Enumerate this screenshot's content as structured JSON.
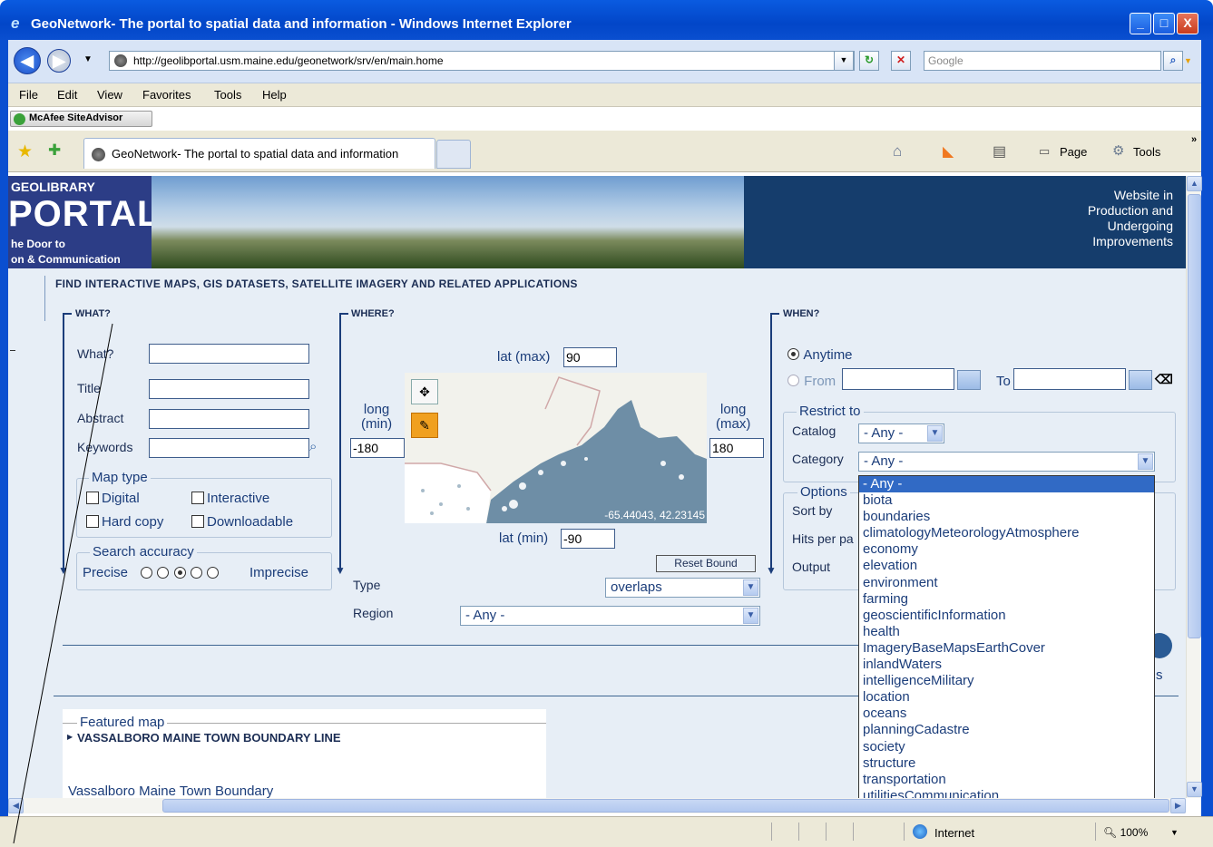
{
  "window": {
    "title": "GeoNetwork- The portal to spatial data and information - Windows Internet Explorer",
    "minimize": "_",
    "maximize": "□",
    "close": "X"
  },
  "address": {
    "url": "http://geolibportal.usm.maine.edu/geonetwork/srv/en/main.home",
    "search_placeholder": "Google"
  },
  "menu": [
    "File",
    "Edit",
    "View",
    "Favorites",
    "Tools",
    "Help"
  ],
  "mcafee": "McAfee SiteAdvisor",
  "tab": {
    "label": "GeoNetwork- The portal to spatial data and information"
  },
  "commandbar": {
    "page": "Page",
    "tools": "Tools"
  },
  "banner": {
    "logo_line1": "GEOLIBRARY",
    "logo_line2": "PORTAL",
    "logo_line3": "he Door to",
    "logo_line4": "on & Communication",
    "notice": "Website in\nProduction and\nUndergoing\nImprovements"
  },
  "search": {
    "heading": "FIND INTERACTIVE MAPS, GIS DATASETS, SATELLITE IMAGERY AND RELATED APPLICATIONS",
    "what": {
      "heading": "WHAT?",
      "fields": [
        "What?",
        "Title",
        "Abstract",
        "Keywords"
      ],
      "map_type_legend": "Map type",
      "map_types": [
        "Digital",
        "Interactive",
        "Hard copy",
        "Downloadable"
      ],
      "accuracy_legend": "Search accuracy",
      "accuracy_left": "Precise",
      "accuracy_right": "Imprecise",
      "accuracy_selected_index": 1
    },
    "where": {
      "heading": "WHERE?",
      "lat_max_label": "lat (max)",
      "lat_max": "90",
      "lat_min_label": "lat (min)",
      "lat_min": "-90",
      "long_min_label": "long\n(min)",
      "long_min": "-180",
      "long_max_label": "long\n(max)",
      "long_max": "180",
      "coords": "-65.44043, 42.23145",
      "reset_label": "Reset Bound",
      "type_label": "Type",
      "type_value": "overlaps",
      "region_label": "Region",
      "region_value": "- Any -"
    },
    "when": {
      "heading": "WHEN?",
      "anytime": "Anytime",
      "from": "From",
      "to": "To",
      "restrict_legend": "Restrict to",
      "catalog_label": "Catalog",
      "catalog_value": "- Any -",
      "category_label": "Category",
      "category_value": "- Any -",
      "options_legend": "Options",
      "sort_label": "Sort by",
      "hits_label": "Hits per pa",
      "output_label": "Output",
      "partial_letter": "s"
    }
  },
  "category_options": [
    "- Any -",
    "biota",
    "boundaries",
    "climatologyMeteorologyAtmosphere",
    "economy",
    "elevation",
    "environment",
    "farming",
    "geoscientificInformation",
    "health",
    "ImageryBaseMapsEarthCover",
    "inlandWaters",
    "intelligenceMilitary",
    "location",
    "oceans",
    "planningCadastre",
    "society",
    "structure",
    "transportation",
    "utilitiesCommunication"
  ],
  "featured": {
    "legend": "Featured map",
    "title": "VASSALBORO MAINE TOWN BOUNDARY LINE",
    "desc": "Vassalboro Maine Town Boundary"
  },
  "status": {
    "zone": "Internet",
    "zoom": "100%"
  }
}
